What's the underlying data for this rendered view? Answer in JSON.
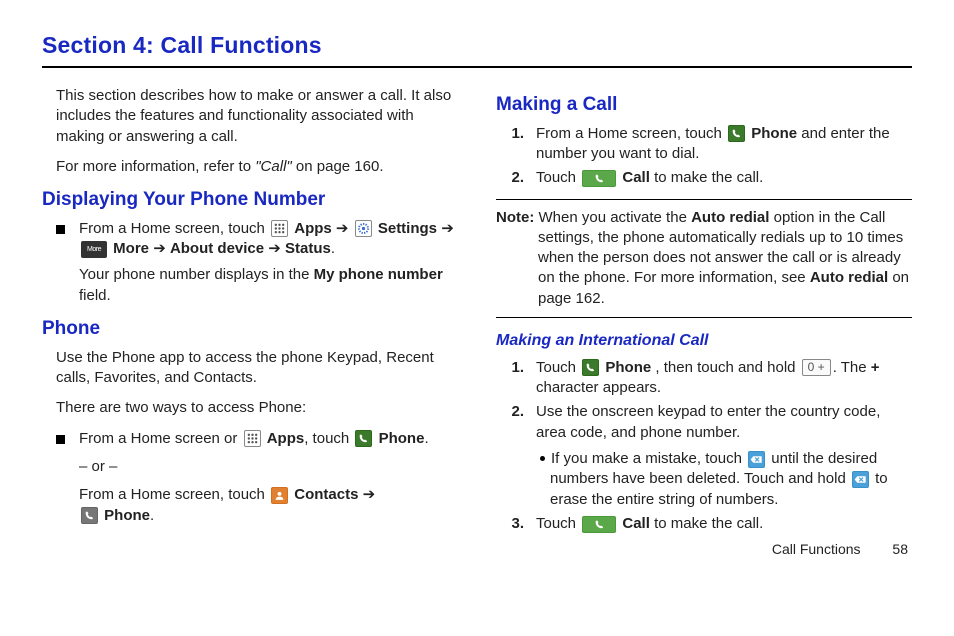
{
  "title": "Section 4: Call Functions",
  "left": {
    "intro1": "This section describes how to make or answer a call. It also includes the features and functionality associated with making or answering a call.",
    "intro2_pre": "For more information, refer to ",
    "intro2_ref": "\"Call\"",
    "intro2_post": " on page 160.",
    "h_display": "Displaying Your Phone Number",
    "display": {
      "l1a": "From a Home screen, touch ",
      "apps": "Apps",
      "arrow": " ➔ ",
      "settings": "Settings",
      "more": "More",
      "about": "About device",
      "status": "Status",
      "period": ".",
      "l2a": "Your phone number displays in the ",
      "l2b": "My phone number",
      "l2c": " field."
    },
    "h_phone": "Phone",
    "phone": {
      "p1": "Use the Phone app to access the phone Keypad, Recent calls, Favorites, and Contacts.",
      "p2": "There are two ways to access Phone:",
      "row1a": "From a Home screen or ",
      "apps": "Apps",
      "comma_touch": ", touch ",
      "phone": "Phone",
      "period": ".",
      "or": "– or –",
      "row2a": "From a Home screen, touch ",
      "contacts": "Contacts",
      "arrow": " ➔ "
    }
  },
  "right": {
    "h_making": "Making a Call",
    "making": {
      "s1a": "From a Home screen, touch ",
      "phone": "Phone",
      "s1b": " and enter the number you want to dial.",
      "s2a": "Touch ",
      "call": "Call",
      "s2b": " to make the call."
    },
    "note": {
      "label": "Note:",
      "t1": " When you activate the ",
      "b1": "Auto redial",
      "t2": " option in the Call settings, the phone automatically redials up to 10 times when the person does not answer the call or is already on the phone. For more information, see ",
      "b2": "Auto redial",
      "t3": " on page 162."
    },
    "h_intl": "Making an International Call",
    "intl": {
      "s1a": "Touch ",
      "phone": "Phone",
      "s1b": ", then touch and hold ",
      "key": "0 +",
      "s1c": ". The ",
      "plus": "+",
      "s1d": " character appears.",
      "s2": "Use the onscreen keypad to enter the country code, area code, and phone number.",
      "sub_a": "If you make a mistake, touch ",
      "sub_b": " until the desired numbers have been deleted. Touch and hold ",
      "sub_c": " to erase the entire string of numbers.",
      "s3a": "Touch ",
      "call": "Call",
      "s3b": " to make the call."
    }
  },
  "footer": {
    "section": "Call Functions",
    "page": "58"
  }
}
